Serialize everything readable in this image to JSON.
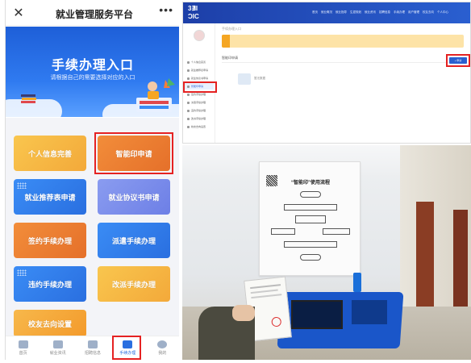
{
  "mobile": {
    "close_icon": "✕",
    "title": "就业管理服务平台",
    "more_icon": "•••",
    "banner": {
      "title": "手续办理入口",
      "subtitle": "请根据自己的需要选择对应的入口"
    },
    "cards": [
      {
        "label": "个人信息完善"
      },
      {
        "label": "智能印申请"
      },
      {
        "label": "就业推荐表申请"
      },
      {
        "label": "就业协议书申请"
      },
      {
        "label": "签约手续办理"
      },
      {
        "label": "派遣手续办理"
      },
      {
        "label": "违约手续办理"
      },
      {
        "label": "改派手续办理"
      },
      {
        "label": "校友去向设置"
      }
    ],
    "tabs": [
      {
        "label": "首页",
        "icon": "home-icon"
      },
      {
        "label": "就业资讯",
        "icon": "news-icon"
      },
      {
        "label": "招聘信息",
        "icon": "briefcase-icon"
      },
      {
        "label": "手续办理",
        "icon": "document-icon"
      },
      {
        "label": "我的",
        "icon": "user-icon"
      }
    ]
  },
  "desktop": {
    "logo": "3∄Ɩ\nƆIC",
    "nav": [
      "首页",
      "就业概况",
      "就业指导",
      "生涯规划",
      "就业资讯",
      "招聘信息",
      "手续办理",
      "用户管理",
      "校友去向",
      "个人中心"
    ],
    "crumb": "手续办理入口",
    "subtitle": "智能印申请",
    "apply_button": "+ 申请",
    "empty_text": "暂无数据",
    "sidebar": [
      "个人信息完善",
      "就业推荐表申请",
      "就业协议书申请",
      "智能印申请",
      "签约手续办理",
      "派遣手续办理",
      "违约手续办理",
      "改派手续办理",
      "校友去向设置"
    ]
  },
  "photo": {
    "poster_title": "“智能印”使用流程"
  },
  "colors": {
    "highlight": "#e52222",
    "brand_blue": "#2a5fd0",
    "orange": "#f39a2b"
  }
}
